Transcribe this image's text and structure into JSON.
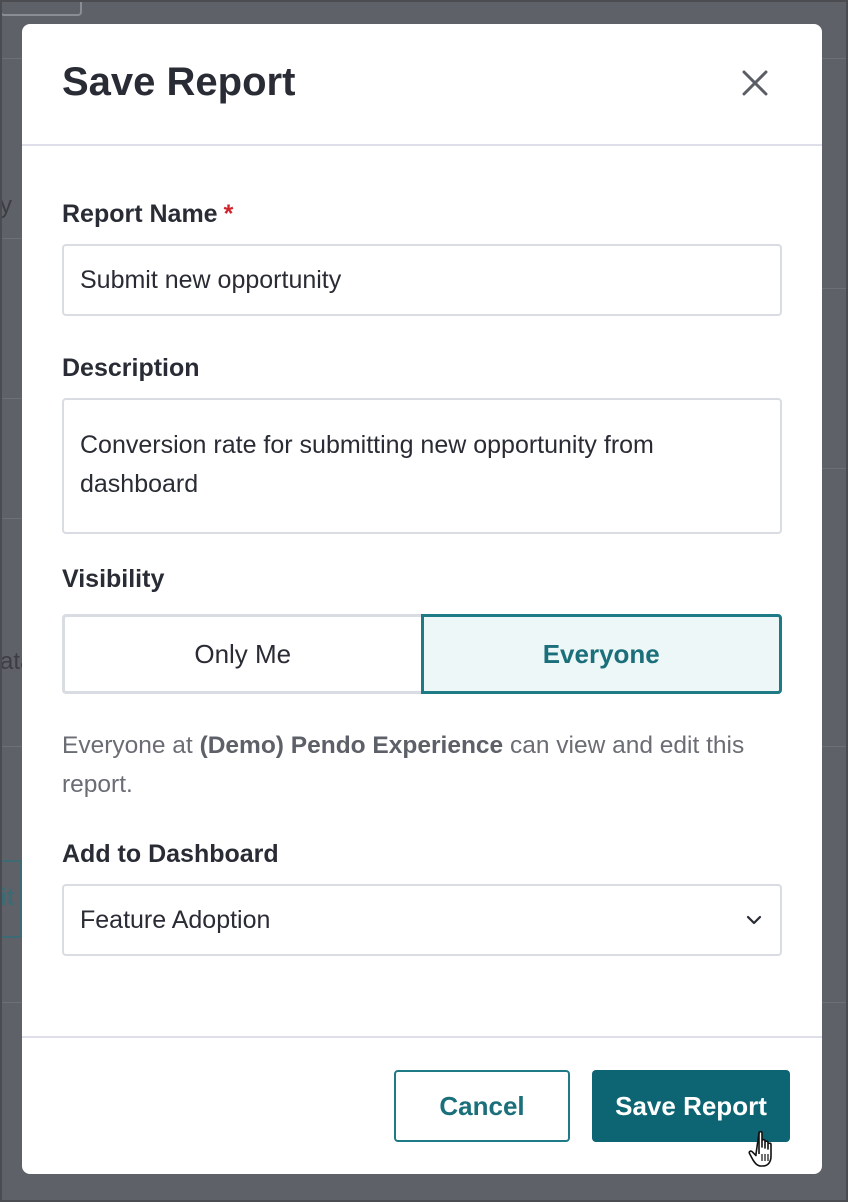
{
  "background": {
    "fragment_texts": [
      "y",
      "ata",
      "it"
    ]
  },
  "modal": {
    "title": "Save Report",
    "close_icon": "close-icon",
    "report_name": {
      "label": "Report Name",
      "required_mark": "*",
      "value": "Submit new opportunity"
    },
    "description": {
      "label": "Description",
      "value": "Conversion rate for submitting new opportunity from dashboard"
    },
    "visibility": {
      "label": "Visibility",
      "options": [
        "Only Me",
        "Everyone"
      ],
      "selected": "Everyone",
      "helper_prefix": "Everyone at ",
      "helper_org": "(Demo) Pendo Experience",
      "helper_suffix": " can view and edit this report."
    },
    "dashboard": {
      "label": "Add to Dashboard",
      "selected": "Feature Adoption",
      "chevron_icon": "chevron-down-icon"
    },
    "footer": {
      "cancel_label": "Cancel",
      "save_label": "Save Report"
    }
  },
  "colors": {
    "accent": "#1e7b86",
    "primary_button": "#0d6472",
    "required": "#d0242b",
    "overlay": "#5e6168"
  }
}
